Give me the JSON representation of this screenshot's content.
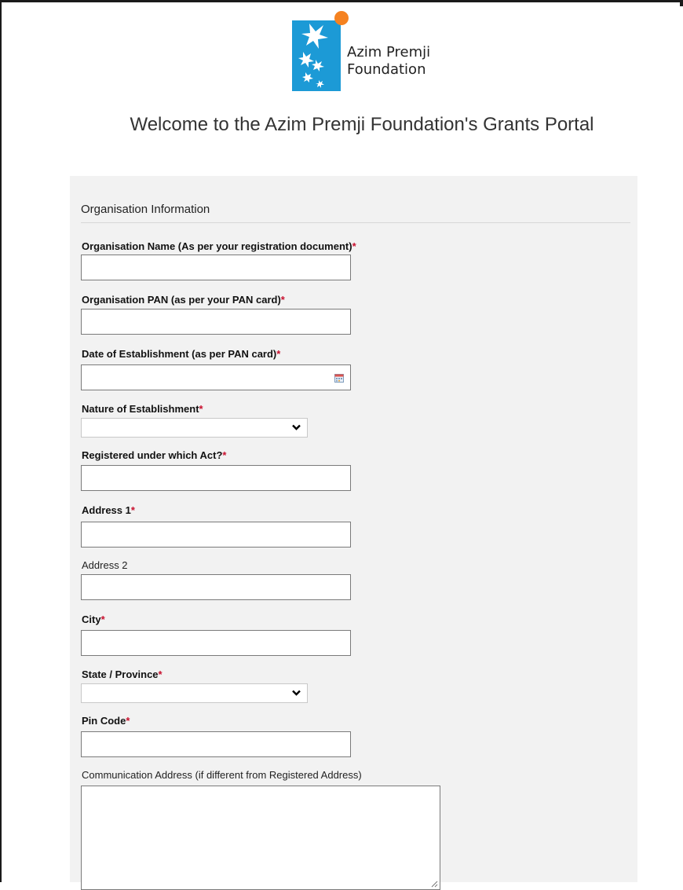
{
  "brand": {
    "logo_line1": "Azim Premji",
    "logo_line2": "Foundation",
    "colors": {
      "logo_blue": "#1c9ad6",
      "logo_orange": "#f58220"
    }
  },
  "page": {
    "welcome": "Welcome to the Azim Premji Foundation's Grants Portal"
  },
  "form": {
    "section_title": "Organisation Information",
    "required_marker": "*",
    "fields": {
      "org_name": {
        "label": "Organisation Name (As per your registration document)",
        "value": ""
      },
      "org_pan": {
        "label": "Organisation PAN (as per your PAN card)",
        "value": ""
      },
      "date_est": {
        "label": "Date of Establishment (as per PAN card)",
        "value": "",
        "icon": "calendar-icon"
      },
      "nature": {
        "label": "Nature of Establishment",
        "selected": "",
        "icon": "chevron-down-icon"
      },
      "act": {
        "label": "Registered under which Act?",
        "value": ""
      },
      "address1": {
        "label": "Address 1",
        "value": ""
      },
      "address2": {
        "label": "Address 2",
        "value": ""
      },
      "city": {
        "label": "City",
        "value": ""
      },
      "state": {
        "label": "State / Province",
        "selected": "",
        "icon": "chevron-down-icon"
      },
      "pincode": {
        "label": "Pin Code",
        "value": ""
      },
      "comm_address": {
        "label": "Communication Address (if different from Registered Address)",
        "value": ""
      }
    }
  }
}
